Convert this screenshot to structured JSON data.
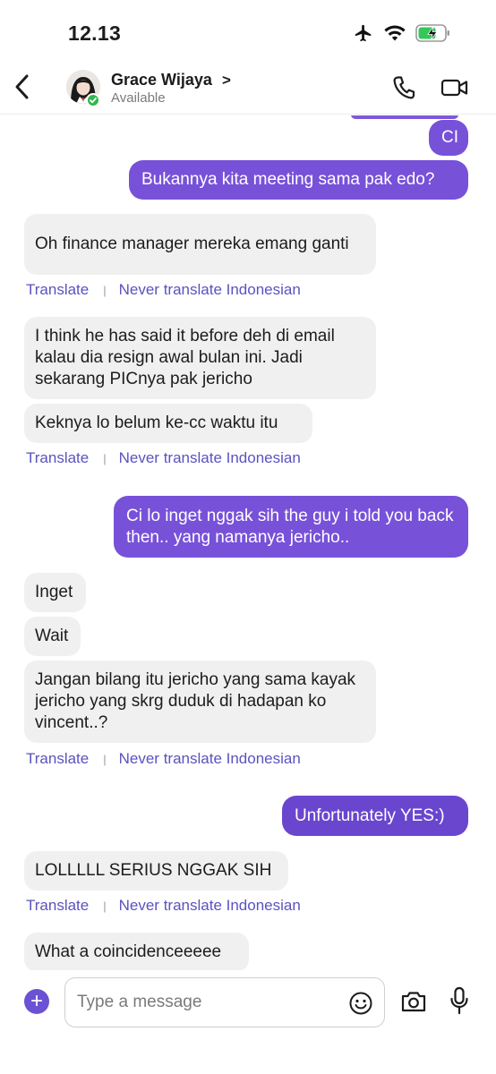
{
  "status_bar": {
    "time": "12.13"
  },
  "header": {
    "contact_name": "Grace Wijaya",
    "chevron": ">",
    "presence_status": "Available",
    "icons": [
      "back-chevron-icon",
      "phone-icon",
      "video-camera-icon"
    ]
  },
  "colors": {
    "accent": "#7851d9",
    "translate_link": "#5a53c0",
    "incoming_bubble": "#f0f0f0",
    "presence_green": "#2fb84d"
  },
  "translate": {
    "translate_label": "Translate",
    "separator": "|",
    "never_label": "Never translate Indonesian"
  },
  "messages": [
    {
      "dir": "out",
      "text": "CI"
    },
    {
      "dir": "out",
      "text": "Bukannya kita meeting sama pak edo?"
    },
    {
      "dir": "in",
      "text": "Oh finance manager mereka emang ganti"
    },
    {
      "dir": "in",
      "text": "I think he has said it before deh di email kalau dia resign awal bulan ini. Jadi sekarang PICnya pak jericho"
    },
    {
      "dir": "in",
      "text": "Keknya lo belum ke-cc waktu itu"
    },
    {
      "dir": "out",
      "text": "Ci lo inget nggak sih the guy i told you back then.. yang namanya jericho.."
    },
    {
      "dir": "in",
      "text": "Inget"
    },
    {
      "dir": "in",
      "text": "Wait"
    },
    {
      "dir": "in",
      "text": "Jangan bilang itu jericho yang sama kayak jericho yang skrg duduk di hadapan ko vincent..?"
    },
    {
      "dir": "out",
      "text": "Unfortunately YES:)"
    },
    {
      "dir": "in",
      "text": "LOLLLLL SERIUS NGGAK SIH"
    },
    {
      "dir": "in",
      "text": "What a coincidenceeeee"
    }
  ],
  "composer": {
    "plus": "+",
    "placeholder": "Type a message",
    "icons": [
      "plus-icon",
      "emoji-icon",
      "camera-icon",
      "microphone-icon"
    ]
  }
}
